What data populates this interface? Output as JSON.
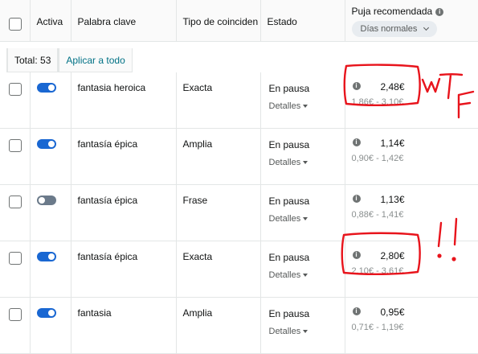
{
  "header": {
    "activa": "Activa",
    "palabra_clave": "Palabra clave",
    "tipo": "Tipo de coinciden",
    "estado": "Estado",
    "puja": "Puja recomendada",
    "info_glyph": "i",
    "rango": "Días normales"
  },
  "summary": {
    "total": "Total: 53",
    "aplicar": "Aplicar a todo"
  },
  "rows": [
    {
      "active": true,
      "keyword": "fantasia heroica",
      "match": "Exacta",
      "status": "En pausa",
      "details": "Detalles",
      "bid": "2,48€",
      "range": "1,86€ - 3,10€"
    },
    {
      "active": true,
      "keyword": "fantasía épica",
      "match": "Amplia",
      "status": "En pausa",
      "details": "Detalles",
      "bid": "1,14€",
      "range": "0,90€ - 1,42€"
    },
    {
      "active": false,
      "keyword": "fantasía épica",
      "match": "Frase",
      "status": "En pausa",
      "details": "Detalles",
      "bid": "1,13€",
      "range": "0,88€ - 1,41€"
    },
    {
      "active": true,
      "keyword": "fantasía épica",
      "match": "Exacta",
      "status": "En pausa",
      "details": "Detalles",
      "bid": "2,80€",
      "range": "2,10€ - 3,61€"
    },
    {
      "active": true,
      "keyword": "fantasia",
      "match": "Amplia",
      "status": "En pausa",
      "details": "Detalles",
      "bid": "0,95€",
      "range": "0,71€ - 1,19€"
    }
  ],
  "annotations": {
    "ink_color": "#e8141c",
    "note_1": "WTF",
    "note_2": "!!"
  }
}
